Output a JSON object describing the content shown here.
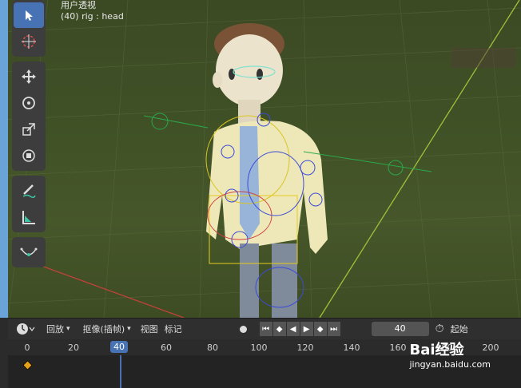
{
  "viewport": {
    "view_label": "用户透视",
    "object_label": "(40) rig : head"
  },
  "toolbar": {
    "tools": [
      "select-box",
      "cursor",
      "move",
      "rotate",
      "scale",
      "transform",
      "annotate",
      "measure",
      "curve"
    ]
  },
  "timeline_header": {
    "playback_label": "回放",
    "keying_label": "抠像(插帧)",
    "view_label": "视图",
    "marker_label": "标记",
    "current_frame": "40",
    "start_label": "起始"
  },
  "timeline": {
    "ticks": [
      "0",
      "20",
      "40",
      "60",
      "80",
      "100",
      "120",
      "140",
      "160",
      "180",
      "200"
    ],
    "current_frame": "40"
  },
  "watermark": {
    "brand": "Bai经验",
    "url": "jingyan.baidu.com"
  },
  "colors": {
    "accent": "#4772b3",
    "keyframe": "#e6a21a"
  }
}
